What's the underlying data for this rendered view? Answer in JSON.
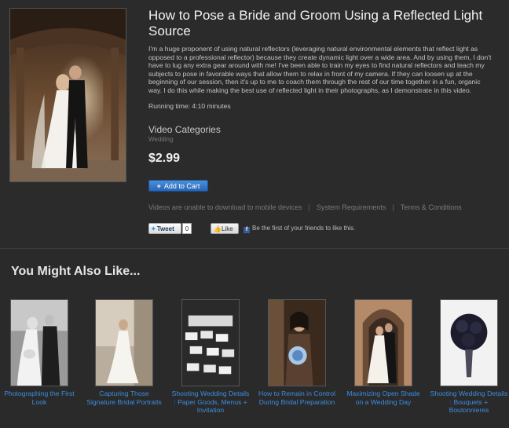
{
  "product": {
    "title": "How to Pose a Bride and Groom Using a Reflected Light Source",
    "description": "I'm a huge proponent of using natural reflectors (leveraging natural environmental elements that reflect light as opposed to a professional reflector) because they create dynamic light over a wide area. And by using them, I don't have to lug any extra gear around with me! I've been able to train my eyes to find natural reflectors and teach my subjects to pose in favorable ways that allow them to relax in front of my camera. If they can loosen up at the beginning of our session, then it's up to me to coach them through the rest of our time together in a fun, organic way. I do this while making the best use of reflected light in their photographs, as I demonstrate in this video.",
    "running_time": "Running time: 4:10 minutes",
    "categories_heading": "Video Categories",
    "category": "Wedding",
    "price": "$2.99",
    "add_to_cart": "Add to Cart"
  },
  "info_links": {
    "mobile_notice": "Videos are unable to download to mobile devices",
    "system_requirements": "System Requirements",
    "terms": "Terms & Conditions",
    "separator": "|"
  },
  "social": {
    "tweet_label": "Tweet",
    "tweet_count": "0",
    "like_label": "Like",
    "fb_text": "Be the first of your friends to like this."
  },
  "related": {
    "heading": "You Might Also Like...",
    "items": [
      {
        "title": "Photographing the First Look"
      },
      {
        "title": "Capturing Those Signature Bridal Portraits"
      },
      {
        "title": "Shooting Wedding Details : Paper Goods, Menus + Invitation"
      },
      {
        "title": "How to Remain in Control During Bridal Preparation"
      },
      {
        "title": "Maximizing Open Shade on a Wedding Day"
      },
      {
        "title": "Shooting Wedding Details : Bouquets + Boutonnieres"
      }
    ]
  },
  "colors": {
    "background": "#2a2a2a",
    "link": "#3c8ee0",
    "button": "#2f74c8"
  }
}
